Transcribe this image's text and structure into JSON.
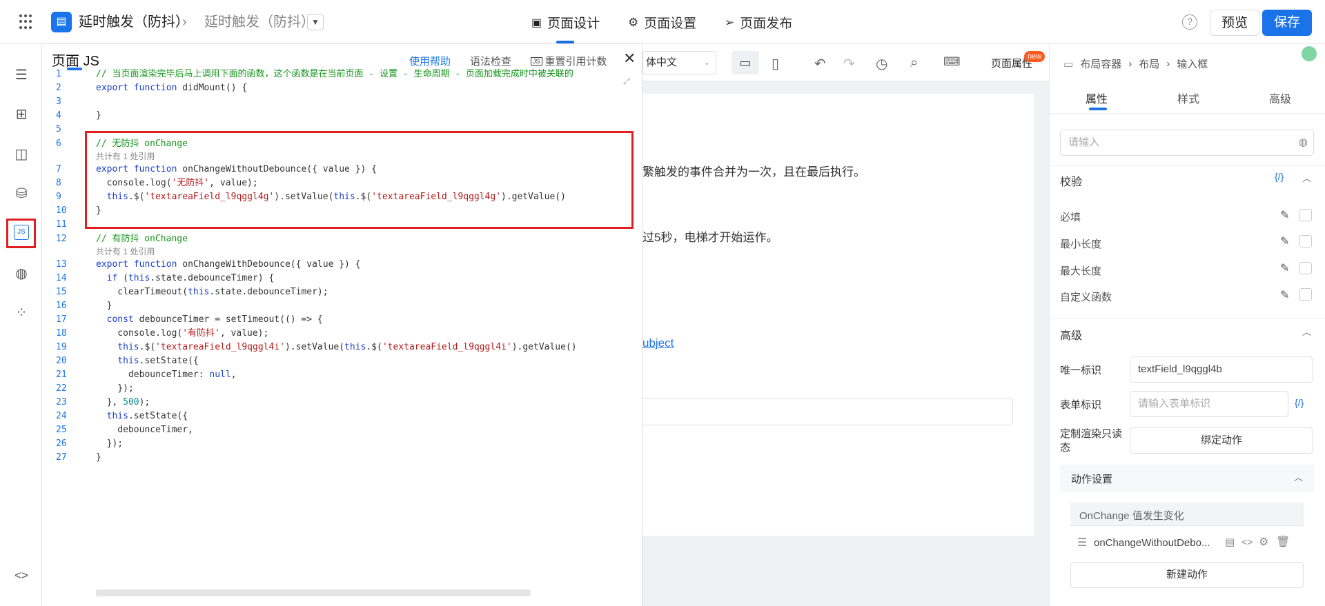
{
  "header": {
    "title": "延时触发（防抖）",
    "breadcrumb_page": "延时触发（防抖）",
    "tabs": [
      {
        "label": "页面设计",
        "icon": "layout-icon"
      },
      {
        "label": "页面设置",
        "icon": "gear-icon"
      },
      {
        "label": "页面发布",
        "icon": "send-icon"
      }
    ],
    "help_icon": "?",
    "preview_label": "预览",
    "save_label": "保存"
  },
  "js_panel": {
    "title": "页面 JS",
    "help_label": "使用帮助",
    "lint_label": "语法检查",
    "reset_label": "重置引用计数",
    "js_badge": "JS",
    "ref_note": "共计有 1 处引用",
    "lines": [
      {
        "n": "1",
        "code": "// 当页面渲染完毕后马上调用下面的函数，这个函数是在当前页面 - 设置 - 生命周期 - 页面加载完成时中被关联的"
      },
      {
        "n": "2",
        "code": "export function didMount() {"
      },
      {
        "n": "3",
        "code": ""
      },
      {
        "n": "4",
        "code": "}"
      },
      {
        "n": "5",
        "code": ""
      },
      {
        "n": "6",
        "code": "// 无防抖 onChange"
      },
      {
        "n": "7",
        "code": "export function onChangeWithoutDebounce({ value }) {"
      },
      {
        "n": "8",
        "code": "  console.log('无防抖', value);"
      },
      {
        "n": "9",
        "code": "  this.$('textareaField_l9qggl4g').setValue(this.$('textareaField_l9qggl4g').getValue()"
      },
      {
        "n": "10",
        "code": "}"
      },
      {
        "n": "11",
        "code": ""
      },
      {
        "n": "12",
        "code": "// 有防抖 onChange"
      },
      {
        "n": "13",
        "code": "export function onChangeWithDebounce({ value }) {"
      },
      {
        "n": "14",
        "code": "  if (this.state.debounceTimer) {"
      },
      {
        "n": "15",
        "code": "    clearTimeout(this.state.debounceTimer);"
      },
      {
        "n": "16",
        "code": "  }"
      },
      {
        "n": "17",
        "code": "  const debounceTimer = setTimeout(() => {"
      },
      {
        "n": "18",
        "code": "    console.log('有防抖', value);"
      },
      {
        "n": "19",
        "code": "    this.$('textareaField_l9qggl4i').setValue(this.$('textareaField_l9qggl4i').getValue()"
      },
      {
        "n": "20",
        "code": "    this.setState({"
      },
      {
        "n": "21",
        "code": "      debounceTimer: null,"
      },
      {
        "n": "22",
        "code": "    });"
      },
      {
        "n": "23",
        "code": "  }, 500);"
      },
      {
        "n": "24",
        "code": "  this.setState({"
      },
      {
        "n": "25",
        "code": "    debounceTimer,"
      },
      {
        "n": "26",
        "code": "  });"
      },
      {
        "n": "27",
        "code": "}"
      }
    ]
  },
  "canvas": {
    "lang_select": "体中文",
    "page_props_label": "页面属性",
    "new_badge": "new",
    "text_1": "繁触发的事件合并为一次，且在最后执行。",
    "text_2": "过5秒，电梯才开始运作。",
    "link_text": "ubject"
  },
  "right_panel": {
    "breadcrumb": [
      "布局容器",
      "布局",
      "输入框"
    ],
    "tabs": [
      "属性",
      "样式",
      "高级"
    ],
    "top_input_placeholder": "请输入",
    "validation": {
      "title": "校验",
      "code_toggle": "{/}",
      "rules": [
        "必填",
        "最小长度",
        "最大长度",
        "自定义函数"
      ]
    },
    "advanced": {
      "title": "高级",
      "unique_id_label": "唯一标识",
      "unique_id_value": "textField_l9qggl4b",
      "form_id_label": "表单标识",
      "form_id_placeholder": "请输入表单标识",
      "form_id_code": "{/}",
      "custom_readonly_label": "定制渲染只读态",
      "bind_action_label": "绑定动作"
    },
    "actions": {
      "title": "动作设置",
      "event_label": "OnChange 值发生变化",
      "handler": "onChangeWithoutDebo...",
      "new_action_label": "新建动作"
    }
  },
  "colors": {
    "accent": "#1a73e8",
    "highlight_border": "#e02020",
    "new_badge": "#ff5a1f"
  }
}
